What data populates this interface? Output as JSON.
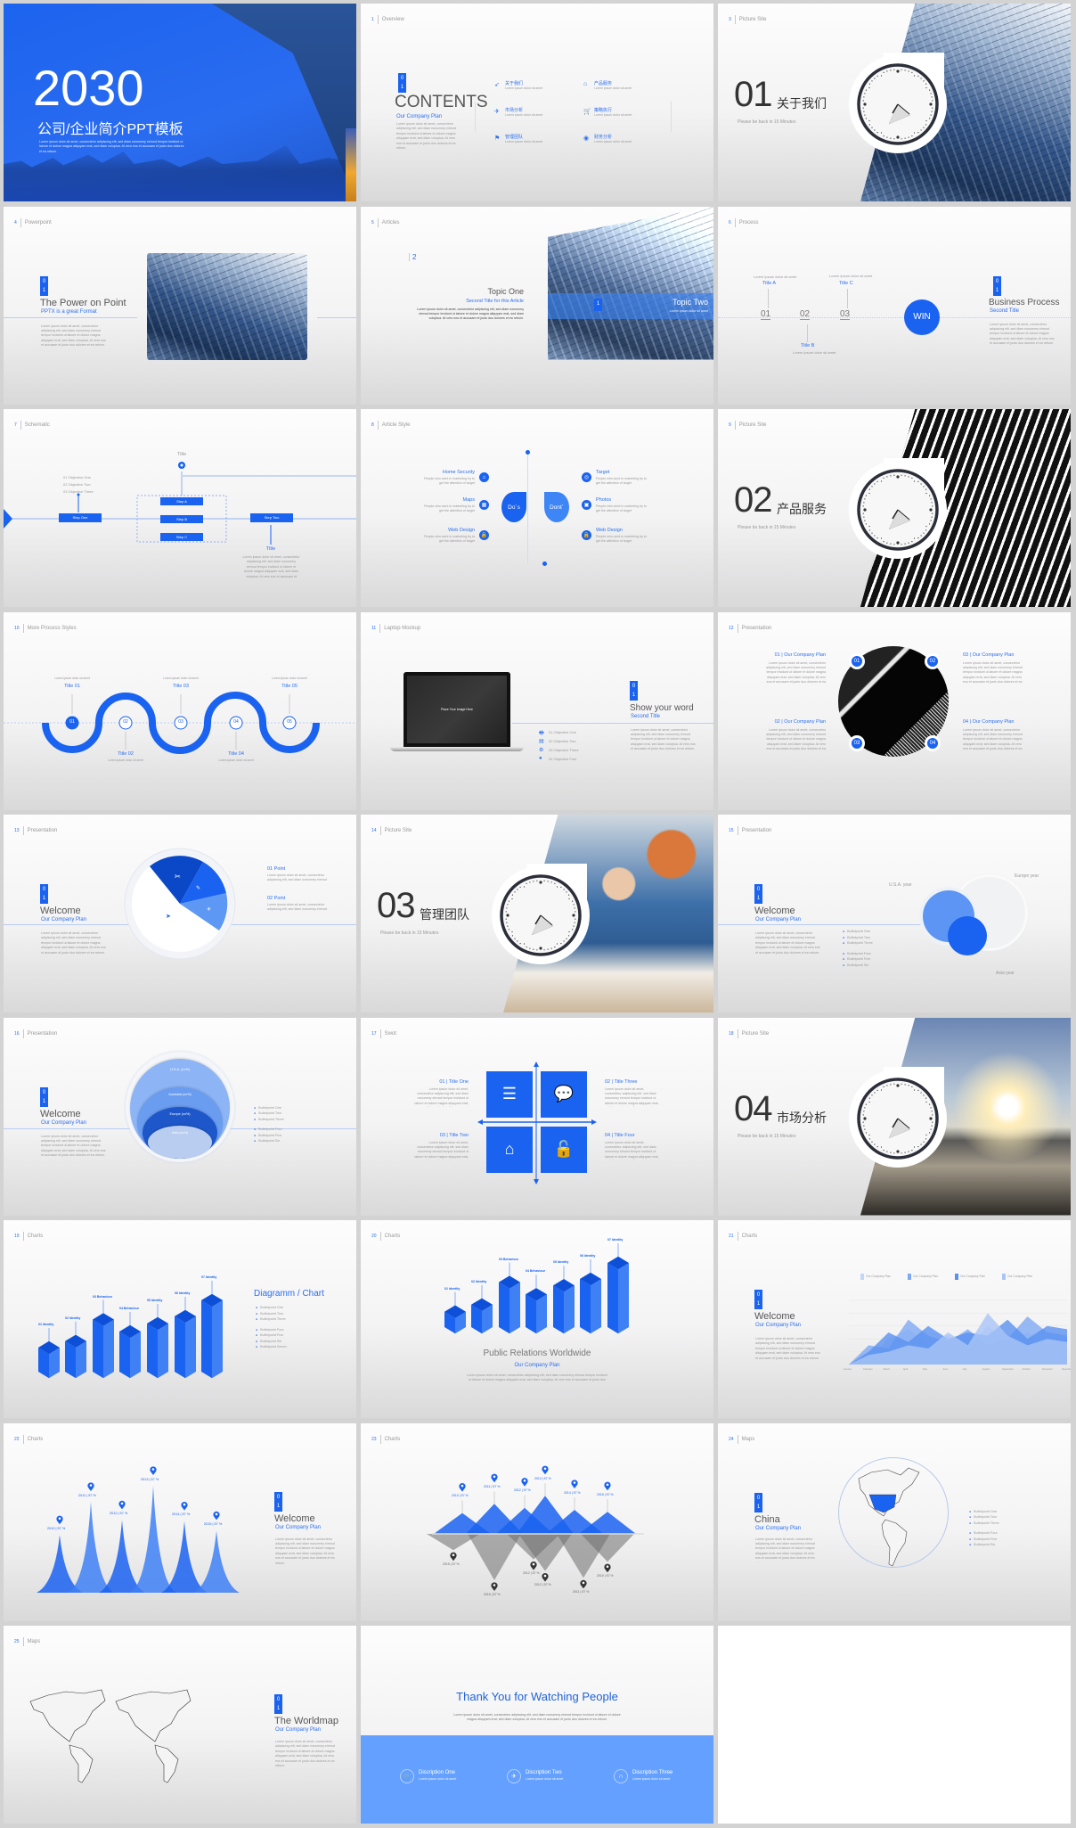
{
  "colors": {
    "accent": "#1a62f0",
    "accent_light": "#64a0ff",
    "text": "#555555",
    "muted": "#999999",
    "page_bg": "#d3d3d3"
  },
  "lorem": "Lorem ipsum dolor sit amet, consectetur adipiscing elit, sed diam nonummy eirmod tempor invidunt ut labore et dolore magna aliquyam erat, sed diam voluptua. At vero eos et accusam et justo duo dolores et ea rebum.",
  "lorem_short": "Lorem ipsum dolor sit amet",
  "box_digits": [
    "0",
    "1"
  ],
  "slides": [
    {
      "title": "2030",
      "subtitle": "公司/企业简介PPT模板"
    },
    {
      "num": "1",
      "section": "Overview",
      "title": "CONTENTS",
      "subtitle": "Our Company Plan",
      "items": [
        {
          "label": "关于我们",
          "icon": "rocket-icon"
        },
        {
          "label": "产品服务",
          "icon": "home-icon"
        },
        {
          "label": "市场分析",
          "icon": "send-icon"
        },
        {
          "label": "策略执行",
          "icon": "cart-icon"
        },
        {
          "label": "管理团队",
          "icon": "flag-icon"
        },
        {
          "label": "财务分析",
          "icon": "camera-icon"
        }
      ]
    },
    {
      "num": "3",
      "section": "Picture Site",
      "big": "01",
      "cn": "关于我们",
      "note": "Please be back in 15 Minutes"
    },
    {
      "num": "4",
      "section": "Powerpoint",
      "title": "The Power on Point",
      "subtitle": "PPTX is a great Format"
    },
    {
      "num": "5",
      "section": "Articles",
      "digit": "2",
      "title": "Topic One",
      "subtitle": "Second Title for this Article",
      "title2": "Topic Two",
      "digit2": "1"
    },
    {
      "num": "6",
      "section": "Process",
      "title_a": "Title A",
      "title_b": "Title B",
      "title_c": "Title C",
      "steps": [
        "01",
        "02",
        "03"
      ],
      "win": "WIN",
      "title": "Business Process",
      "subtitle": "Second Title"
    },
    {
      "num": "7",
      "section": "Schematic",
      "title_top": "Title",
      "title_bottom": "Title",
      "step_one": "Step One",
      "step_two": "Step Two",
      "steps": [
        "Step A",
        "Step B",
        "Step C"
      ],
      "objectives": [
        "01 Objective One",
        "02 Objective Two",
        "03 Objective Three"
      ]
    },
    {
      "num": "8",
      "section": "Article Style",
      "dos": "Do´s",
      "donts": "Dont´",
      "left": [
        "Home Security",
        "Maps",
        "Web Design"
      ],
      "right": [
        "Target",
        "Photos",
        "Web Design"
      ],
      "item_text": "People who work in marketing try to get the attention of target"
    },
    {
      "num": "9",
      "section": "Picture Site",
      "big": "02",
      "cn": "产品服务",
      "note": "Please be back in 15 Minutes"
    },
    {
      "num": "10",
      "section": "More Process Styles",
      "nodes": [
        "01",
        "02",
        "03",
        "04",
        "05"
      ],
      "titles": [
        "Title 01",
        "Title 02",
        "Title 03",
        "Title 04",
        "Title 05"
      ]
    },
    {
      "num": "11",
      "section": "Laptop Mockup",
      "screen": "Place Your Image Here",
      "title": "Show your word",
      "subtitle": "Second Title",
      "objectives": [
        "01 Objective One",
        "02 Objective Two",
        "03 Objective Three",
        "04 Objective Four"
      ]
    },
    {
      "num": "12",
      "section": "Presentation",
      "points": [
        "01 | Our Company Plan",
        "02 | Our Company Plan",
        "03 | Our Company Plan",
        "04 | Our Company Plan"
      ],
      "badges": [
        "01",
        "02",
        "03",
        "04"
      ]
    },
    {
      "num": "13",
      "section": "Presentation",
      "title": "Welcome",
      "subtitle": "Our Company Plan",
      "points": [
        "01 Point",
        "02 Point"
      ]
    },
    {
      "num": "14",
      "section": "Picture Site",
      "big": "03",
      "cn": "管理团队",
      "note": "Please be back in 15 Minutes"
    },
    {
      "num": "15",
      "section": "Presentation",
      "title": "Welcome",
      "subtitle": "Our Company Plan",
      "labels": [
        "U.S.A. year",
        "Europe year",
        "Asia year"
      ],
      "bullets": [
        "Bulletpoint One",
        "Bulletpoint Two",
        "Bulletpoint Three",
        "Bulletpoint Four",
        "Bulletpoint Five",
        "Bulletpoint Six"
      ]
    },
    {
      "num": "16",
      "section": "Presentation",
      "title": "Welcome",
      "subtitle": "Our Company Plan",
      "layers": [
        "U.S.A. (xx%)",
        "Australia (xx%)",
        "Europe (xx%)",
        "Asia (xx%)"
      ],
      "bullets": [
        "Bulletpoint One",
        "Bulletpoint Two",
        "Bulletpoint Three",
        "Bulletpoint Four",
        "Bulletpoint Five",
        "Bulletpoint Six"
      ]
    },
    {
      "num": "17",
      "section": "Swot",
      "titles": [
        "01 | Title One",
        "02 | Title Three",
        "03 | Title Two",
        "04 | Title Four"
      ]
    },
    {
      "num": "18",
      "section": "Picture Site",
      "big": "04",
      "cn": "市场分析",
      "note": "Please be back in 15 Minutes"
    },
    {
      "num": "19",
      "section": "Charts",
      "title": "Diagramm / Chart",
      "bars": [
        {
          "label": "01 Identity",
          "level": 30
        },
        {
          "label": "02 Identity",
          "level": 38
        },
        {
          "label": "03 Behaviour",
          "level": 65
        },
        {
          "label": "04 Behaviour",
          "level": 50
        },
        {
          "label": "05 Identity",
          "level": 60
        },
        {
          "label": "06 Identity",
          "level": 69
        },
        {
          "label": "07 Identity",
          "level": 89
        }
      ],
      "bullets": [
        "Bulletpoint One",
        "Bulletpoint Two",
        "Bulletpoint Three",
        "Bulletpoint Four",
        "Bulletpoint Five",
        "Bulletpoint Six",
        "Bulletpoint Seven"
      ]
    },
    {
      "num": "20",
      "section": "Charts",
      "title": "Public Relations Worldwide",
      "subtitle": "Our Company Plan",
      "bars": [
        {
          "label": "01 Identity",
          "level": 24
        },
        {
          "label": "02 Identity",
          "level": 35
        },
        {
          "label": "03 Behaviour",
          "level": 70
        },
        {
          "label": "04 Behaviour",
          "level": 51
        },
        {
          "label": "05 Identity",
          "level": 65
        },
        {
          "label": "06 Identity",
          "level": 75
        },
        {
          "label": "07 Identity",
          "level": 100
        }
      ]
    },
    {
      "num": "21",
      "section": "Charts",
      "title": "Welcome",
      "subtitle": "Our Company Plan",
      "legend": [
        "Our Company Plan",
        "Our Company Plan",
        "Our Company Plan",
        "Our Company Plan"
      ],
      "months": [
        "January",
        "February",
        "March",
        "April",
        "May",
        "June",
        "July",
        "August",
        "September",
        "October",
        "November",
        "December"
      ],
      "series": [
        [
          0,
          10,
          40,
          55,
          30,
          45,
          25,
          60,
          35,
          50,
          30,
          40
        ],
        [
          0,
          30,
          25,
          70,
          45,
          35,
          55,
          30,
          40,
          75,
          50,
          45
        ],
        [
          0,
          20,
          50,
          35,
          60,
          40,
          50,
          45,
          70,
          40,
          60,
          55
        ],
        [
          0,
          15,
          20,
          30,
          25,
          50,
          30,
          80,
          45,
          30,
          40,
          35
        ]
      ]
    },
    {
      "num": "22",
      "section": "Charts",
      "title": "Welcome",
      "subtitle": "Our Company Plan",
      "peaks": [
        {
          "label": "2010 | 57 %",
          "level": 54
        },
        {
          "label": "2011 | 57 %",
          "level": 85
        },
        {
          "label": "2012 | 57 %",
          "level": 68
        },
        {
          "label": "2013 | 57 %",
          "level": 100
        },
        {
          "label": "2014 | 57 %",
          "level": 67
        },
        {
          "label": "2015 | 57 %",
          "level": 58
        }
      ]
    },
    {
      "num": "23",
      "section": "Charts",
      "top": [
        {
          "label": "2010 | 57 %",
          "level": 52
        },
        {
          "label": "2011 | 57 %",
          "level": 75
        },
        {
          "label": "2012 | 57 %",
          "level": 65
        },
        {
          "label": "2013 | 57 %",
          "level": 95
        },
        {
          "label": "2014 | 57 %",
          "level": 60
        },
        {
          "label": "2015 | 57 %",
          "level": 55
        }
      ],
      "bottom": [
        {
          "label": "2015 | 57 %",
          "level": 35
        },
        {
          "label": "2016 | 57 %",
          "level": 100
        },
        {
          "label": "2012 | 57 %",
          "level": 55
        },
        {
          "label": "2012 | 57 %",
          "level": 80
        },
        {
          "label": "2011 | 57 %",
          "level": 95
        },
        {
          "label": "2010 | 57 %",
          "level": 60
        }
      ]
    },
    {
      "num": "24",
      "section": "Maps",
      "title": "China",
      "subtitle": "Our Company Plan",
      "bullets": [
        "Bulletpoint One",
        "Bulletpoint Two",
        "Bulletpoint Three",
        "Bulletpoint Four",
        "Bulletpoint Five",
        "Bulletpoint Six"
      ]
    },
    {
      "num": "25",
      "section": "Maps",
      "title": "The Worldmap",
      "subtitle": "Our Company Plan"
    },
    {
      "title": "Thank You for Watching People",
      "items": [
        {
          "label": "Discription One",
          "icon": "cart-icon"
        },
        {
          "label": "Discription Two",
          "icon": "send-icon"
        },
        {
          "label": "Discription Three",
          "icon": "magnet-icon"
        }
      ]
    }
  ]
}
